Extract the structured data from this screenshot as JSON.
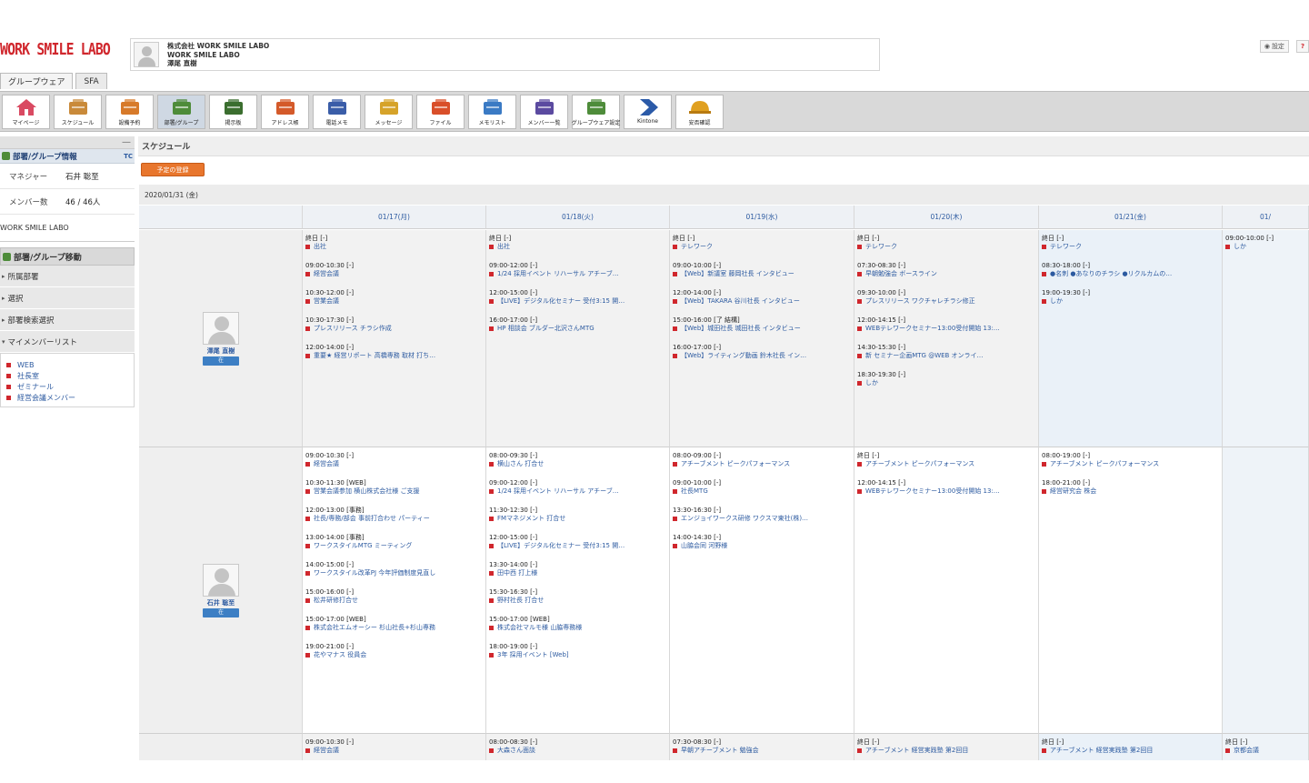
{
  "header": {
    "logo": "WORK SMILE LABO",
    "company_lines": [
      "株式会社 WORK SMILE LABO",
      "WORK SMILE LABO",
      "澤尾 直樹"
    ],
    "top_right": {
      "settings_label": "設定",
      "help_label": "?"
    },
    "tabs": [
      "グループウェア",
      "SFA"
    ]
  },
  "toolbar": {
    "items": [
      {
        "label": "マイページ",
        "icon": "home-icon"
      },
      {
        "label": "スケジュール",
        "icon": "schedule-icon"
      },
      {
        "label": "設備予約",
        "icon": "facility-icon"
      },
      {
        "label": "部署/グループ",
        "icon": "group-icon",
        "active": true
      },
      {
        "label": "掲示板",
        "icon": "board-icon"
      },
      {
        "label": "アドレス帳",
        "icon": "address-icon"
      },
      {
        "label": "電話メモ",
        "icon": "phone-memo-icon"
      },
      {
        "label": "メッセージ",
        "icon": "message-icon"
      },
      {
        "label": "ファイル",
        "icon": "file-icon"
      },
      {
        "label": "メモリスト",
        "icon": "memo-icon"
      },
      {
        "label": "メンバー一覧",
        "icon": "members-icon"
      },
      {
        "label": "グループウェア設定",
        "icon": "gw-settings-icon"
      },
      {
        "label": "Kintone",
        "icon": "arrow-app-icon"
      },
      {
        "label": "安否確認",
        "icon": "helmet-icon"
      }
    ]
  },
  "sidebar": {
    "section_title": "部署/グループ情報",
    "section_link": "TC",
    "rows": [
      {
        "key": "マネジャー",
        "value": "石井 聡至"
      },
      {
        "key": "メンバー数",
        "value": "46 / 46人"
      }
    ],
    "company": "WORK SMILE LABO",
    "move_title": "部署/グループ移動",
    "items": [
      "所属部署",
      "選択",
      "部署検索選択",
      "マイメンバーリスト"
    ],
    "links": [
      "WEB",
      "社長室",
      "ゼミナール",
      "経営会議メンバー"
    ]
  },
  "main": {
    "title": "スケジュール",
    "add_button": "予定の登録",
    "date_label": "2020/01/31 (金)",
    "days": [
      "01/17(月)",
      "01/18(火)",
      "01/19(水)",
      "01/20(木)",
      "01/21(金)",
      "01/"
    ]
  },
  "users": [
    {
      "name": "澤尾 直樹",
      "status": "在",
      "days": [
        [
          {
            "time": "終日 [-]",
            "title": "出社"
          },
          {
            "time": "09:00-10:30 [-]",
            "title": "経営会議"
          },
          {
            "time": "10:30-12:00 [-]",
            "title": "営業会議"
          },
          {
            "time": "10:30-17:30 [-]",
            "title": "プレスリリース チラシ作成"
          },
          {
            "time": "12:00-14:00 [-]",
            "title": "重要★ 経営リポート 高橋専務 取材 打ち…"
          }
        ],
        [
          {
            "time": "終日 [-]",
            "title": "出社"
          },
          {
            "time": "09:00-12:00 [-]",
            "title": "1/24 採用イベント リハーサル アチーブ…"
          },
          {
            "time": "12:00-15:00 [-]",
            "title": "【LIVE】デジタル化セミナー 受付3:15 開…"
          },
          {
            "time": "16:00-17:00 [-]",
            "title": "HP 相談会 ブルダー北沢さんMTG"
          }
        ],
        [
          {
            "time": "終日 [-]",
            "title": "テレワーク"
          },
          {
            "time": "09:00-10:00 [-]",
            "title": "【Web】新議室 藤岡社長 インタビュー"
          },
          {
            "time": "12:00-14:00 [-]",
            "title": "【Web】TAKARA 谷川社長 インタビュー"
          },
          {
            "time": "15:00-16:00 [了 結構]",
            "title": "【Web】城田社長 城田社長 インタビュー"
          },
          {
            "time": "16:00-17:00 [-]",
            "title": "【Web】ライティング動画 鈴木社長 イン…"
          }
        ],
        [
          {
            "time": "終日 [-]",
            "title": "テレワーク"
          },
          {
            "time": "07:30-08:30 [-]",
            "title": "早朝勉強会 ボースライン"
          },
          {
            "time": "09:30-10:00 [-]",
            "title": "プレスリリース ワクチャレチラシ修正"
          },
          {
            "time": "12:00-14:15 [-]",
            "title": "WEBテレワークセミナー13:00受付開始 13:…"
          },
          {
            "time": "14:30-15:30 [-]",
            "title": "新 セミナー企画MTG @WEB オンライ…"
          },
          {
            "time": "18:30-19:30 [-]",
            "title": "しか"
          }
        ],
        [
          {
            "time": "終日 [-]",
            "title": "テレワーク"
          },
          {
            "time": "08:30-18:00 [-]",
            "title": "●名刺 ●あなりのチラシ ●リクルカムの…"
          },
          {
            "time": "19:00-19:30 [-]",
            "title": "しか"
          }
        ],
        [
          {
            "time": "09:00-10:00 [-]",
            "title": "しか"
          }
        ]
      ]
    },
    {
      "name": "石井 聡至",
      "status": "在",
      "days": [
        [
          {
            "time": "09:00-10:30 [-]",
            "title": "経営会議"
          },
          {
            "time": "10:30-11:30 [WEB]",
            "title": "営業会議参加 横山株式会社様 ご支援"
          },
          {
            "time": "12:00-13:00 [事務]",
            "title": "社長/専務/部会 事前打合わせ パーティー"
          },
          {
            "time": "13:00-14:00 [事務]",
            "title": "ワークスタイルMTG ミーティング"
          },
          {
            "time": "14:00-15:00 [-]",
            "title": "ワークスタイル改革PJ 今年評価制度見直し"
          },
          {
            "time": "15:00-16:00 [-]",
            "title": "松井研修打合せ"
          },
          {
            "time": "15:00-17:00 [WEB]",
            "title": "株式会社エムオーシー 杉山社長+杉山専務"
          },
          {
            "time": "19:00-21:00 [-]",
            "title": "花やマナス 役員会"
          }
        ],
        [
          {
            "time": "08:00-09:30 [-]",
            "title": "横山さん 打合せ"
          },
          {
            "time": "09:00-12:00 [-]",
            "title": "1/24 採用イベント リハーサル アチーブ…"
          },
          {
            "time": "11:30-12:30 [-]",
            "title": "FMマネジメント 打合せ"
          },
          {
            "time": "12:00-15:00 [-]",
            "title": "【LIVE】デジタル化セミナー 受付3:15 開…"
          },
          {
            "time": "13:30-14:00 [-]",
            "title": "田中西 打上様"
          },
          {
            "time": "15:30-16:30 [-]",
            "title": "野村社長 打合せ"
          },
          {
            "time": "15:00-17:00 [WEB]",
            "title": "株式会社マルモ様 山脇専務様"
          },
          {
            "time": "18:00-19:00 [-]",
            "title": "3年 採用イベント [Web]"
          }
        ],
        [
          {
            "time": "08:00-09:00 [-]",
            "title": "アチーブメント ピークパフォーマンス"
          },
          {
            "time": "09:00-10:00 [-]",
            "title": "社長MTG"
          },
          {
            "time": "13:30-16:30 [-]",
            "title": "エンジョイワークス研修 ワクスマ東社(株)…"
          },
          {
            "time": "14:00-14:30 [-]",
            "title": "山脇会同 河野様"
          }
        ],
        [
          {
            "time": "終日 [-]",
            "title": "アチーブメント ピークパフォーマンス"
          },
          {
            "time": "12:00-14:15 [-]",
            "title": "WEBテレワークセミナー13:00受付開始 13:…"
          }
        ],
        [
          {
            "time": "08:00-19:00 [-]",
            "title": "アチーブメント ピークパフォーマンス"
          },
          {
            "time": "18:00-21:00 [-]",
            "title": "経営研究会 株会"
          }
        ],
        []
      ]
    },
    {
      "name": "",
      "status": "",
      "days": [
        [
          {
            "time": "09:00-10:30 [-]",
            "title": "経営会議"
          }
        ],
        [
          {
            "time": "08:00-08:30 [-]",
            "title": "大森さん面談"
          }
        ],
        [
          {
            "time": "07:30-08:30 [-]",
            "title": "早朝アチーブメント 勉強会"
          }
        ],
        [
          {
            "time": "終日 [-]",
            "title": "アチーブメント 経営実践塾 第2回目"
          }
        ],
        [
          {
            "time": "終日 [-]",
            "title": "アチーブメント 経営実践塾 第2回目"
          }
        ],
        [
          {
            "time": "終日 [-]",
            "title": "京都会議"
          }
        ]
      ]
    }
  ],
  "colors": {
    "brand": "#d0272d",
    "link": "#2c5aa0",
    "add_button": "#e8762d"
  }
}
